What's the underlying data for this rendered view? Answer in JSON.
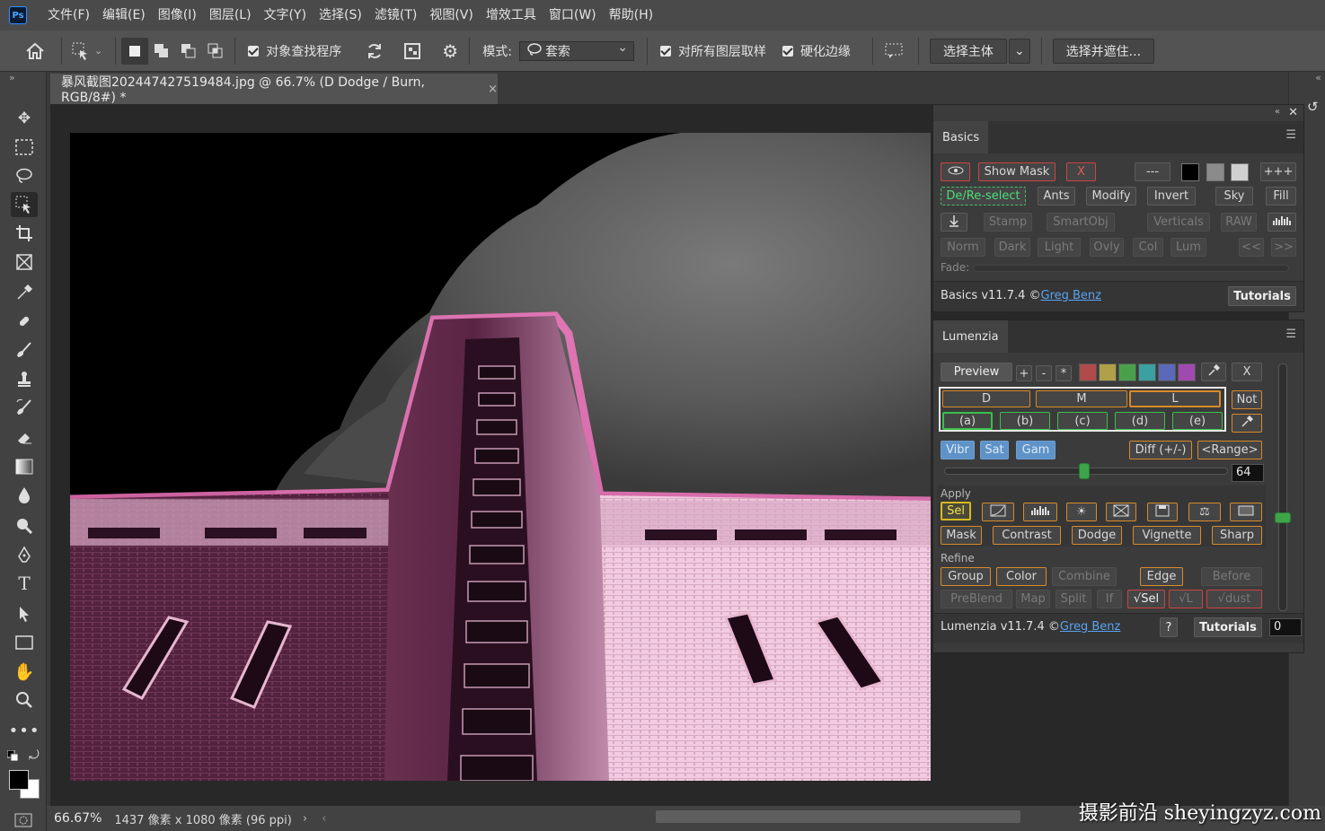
{
  "app": {
    "logo": "Ps"
  },
  "menu": [
    "文件(F)",
    "编辑(E)",
    "图像(I)",
    "图层(L)",
    "文字(Y)",
    "选择(S)",
    "滤镜(T)",
    "视图(V)",
    "增效工具",
    "窗口(W)",
    "帮助(H)"
  ],
  "options": {
    "object_finder": "对象查找程序",
    "mode_label": "模式:",
    "mode_value": "套索",
    "sample_all_layers": "对所有图层取样",
    "hard_edge": "硬化边缘",
    "select_subject": "选择主体",
    "select_and_mask": "选择并遮住..."
  },
  "document": {
    "tab_title": "暴风截图202447427519484.jpg @ 66.7% (D Dodge / Burn, RGB/8#) *",
    "close": "×"
  },
  "status": {
    "zoom": "66.67%",
    "info": "1437 像素 x 1080 像素 (96 ppi)",
    "arrow": "›",
    "left": "‹"
  },
  "basics": {
    "tab": "Basics",
    "show_mask": "Show Mask",
    "x": "X",
    "dashes": "---",
    "plus3": "+++",
    "dereselect": "De/Re-select",
    "ants": "Ants",
    "modify": "Modify",
    "invert": "Invert",
    "sky": "Sky",
    "fill": "Fill",
    "stamp": "Stamp",
    "smartobj": "SmartObj",
    "verticals": "Verticals",
    "raw": "RAW",
    "norm": "Norm",
    "dark": "Dark",
    "light": "Light",
    "ovly": "Ovly",
    "col": "Col",
    "lum": "Lum",
    "prev": "<<",
    "next": ">>",
    "fade": "Fade:",
    "version": "Basics v11.7.4 ©",
    "author": "Greg Benz",
    "tutorials": "Tutorials",
    "swatch_colors": [
      "#000000",
      "#8a8a8a",
      "#d0d0d0"
    ]
  },
  "lumenzia": {
    "tab": "Lumenzia",
    "preview": "Preview",
    "plus": "+",
    "minus": "-",
    "star": "*",
    "x": "X",
    "color_swatches": [
      "#b04b4b",
      "#b0a04a",
      "#4aa04a",
      "#3aa0a0",
      "#5a6ab8",
      "#a04ab0"
    ],
    "d": "D",
    "m": "M",
    "l": "L",
    "not": "Not",
    "zones": [
      "(a)",
      "(b)",
      "(c)",
      "(d)",
      "(e)"
    ],
    "vibr": "Vibr",
    "sat": "Sat",
    "gam": "Gam",
    "diff": "Diff (+/-)",
    "range": "<Range>",
    "slider_value": "64",
    "apply_label": "Apply",
    "sel": "Sel",
    "apply_buttons": [
      "Mask",
      "Contrast",
      "Dodge",
      "Vignette",
      "Sharp"
    ],
    "refine_label": "Refine",
    "refine_row1": [
      "Group",
      "Color",
      "Combine",
      "Edge",
      "Before"
    ],
    "refine_row2": [
      "PreBlend",
      "Map",
      "Split",
      "If",
      "√Sel",
      "√L",
      "√dust"
    ],
    "version": "Lumenzia v11.7.4 ©",
    "author": "Greg Benz",
    "help": "?",
    "tutorials": "Tutorials",
    "vertical_value": "0"
  },
  "watermark": "摄影前沿 sheyingzyz.com"
}
